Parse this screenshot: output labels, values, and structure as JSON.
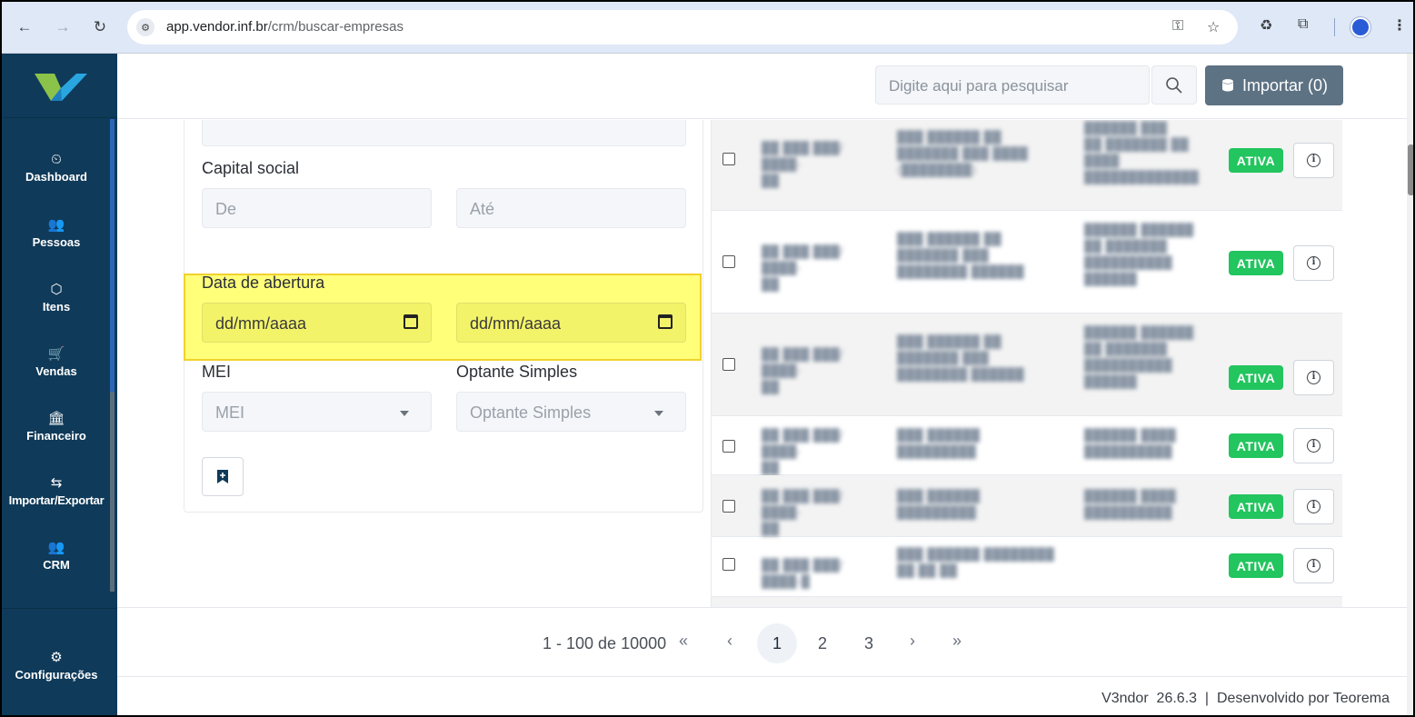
{
  "browser": {
    "url_host": "app.vendor.inf.br",
    "url_path": "/crm/buscar-empresas",
    "icons": [
      "back-icon",
      "forward-icon",
      "reload-icon",
      "site-settings-icon",
      "key-icon",
      "star-icon",
      "extensions-icon",
      "menu-icon"
    ]
  },
  "sidebar": {
    "items": [
      {
        "label": "Dashboard",
        "icon": "⏲"
      },
      {
        "label": "Pessoas",
        "icon": "👥"
      },
      {
        "label": "Itens",
        "icon": "⬡"
      },
      {
        "label": "Vendas",
        "icon": "🛒"
      },
      {
        "label": "Financeiro",
        "icon": "🏛"
      },
      {
        "label": "Importar/Exportar",
        "icon": "⇆"
      },
      {
        "label": "CRM",
        "icon": "👥"
      }
    ],
    "settings_label": "Configurações"
  },
  "topbar": {
    "search_placeholder": "Digite aqui para pesquisar",
    "import_label": "Importar (0)"
  },
  "filters": {
    "capital_social_label": "Capital social",
    "capital_from_placeholder": "De",
    "capital_to_placeholder": "Até",
    "data_abertura_label": "Data de abertura",
    "date_from_placeholder": "dd/mm/aaaa",
    "date_to_placeholder": "dd/mm/aaaa",
    "mei_label": "MEI",
    "mei_value": "MEI",
    "optante_label": "Optante Simples",
    "optante_value": "Optante Simples"
  },
  "results": {
    "rows": [
      {
        "status": "ATIVA"
      },
      {
        "status": "ATIVA"
      },
      {
        "status": "ATIVA"
      },
      {
        "status": "ATIVA"
      },
      {
        "status": "ATIVA"
      },
      {
        "status": "ATIVA"
      }
    ],
    "status_color": "#22c55e"
  },
  "pagination": {
    "summary": "1 - 100 de 10000",
    "first": "«",
    "prev": "‹",
    "pages": [
      "1",
      "2",
      "3"
    ],
    "active_page": "1",
    "next": "›",
    "last": "»"
  },
  "footer": {
    "text": "V3ndor  26.6.3  |  Desenvolvido por Teorema"
  },
  "colors": {
    "sidebar": "#0f3a59",
    "highlight": "#ffff7a",
    "import_button": "#5d7283"
  }
}
